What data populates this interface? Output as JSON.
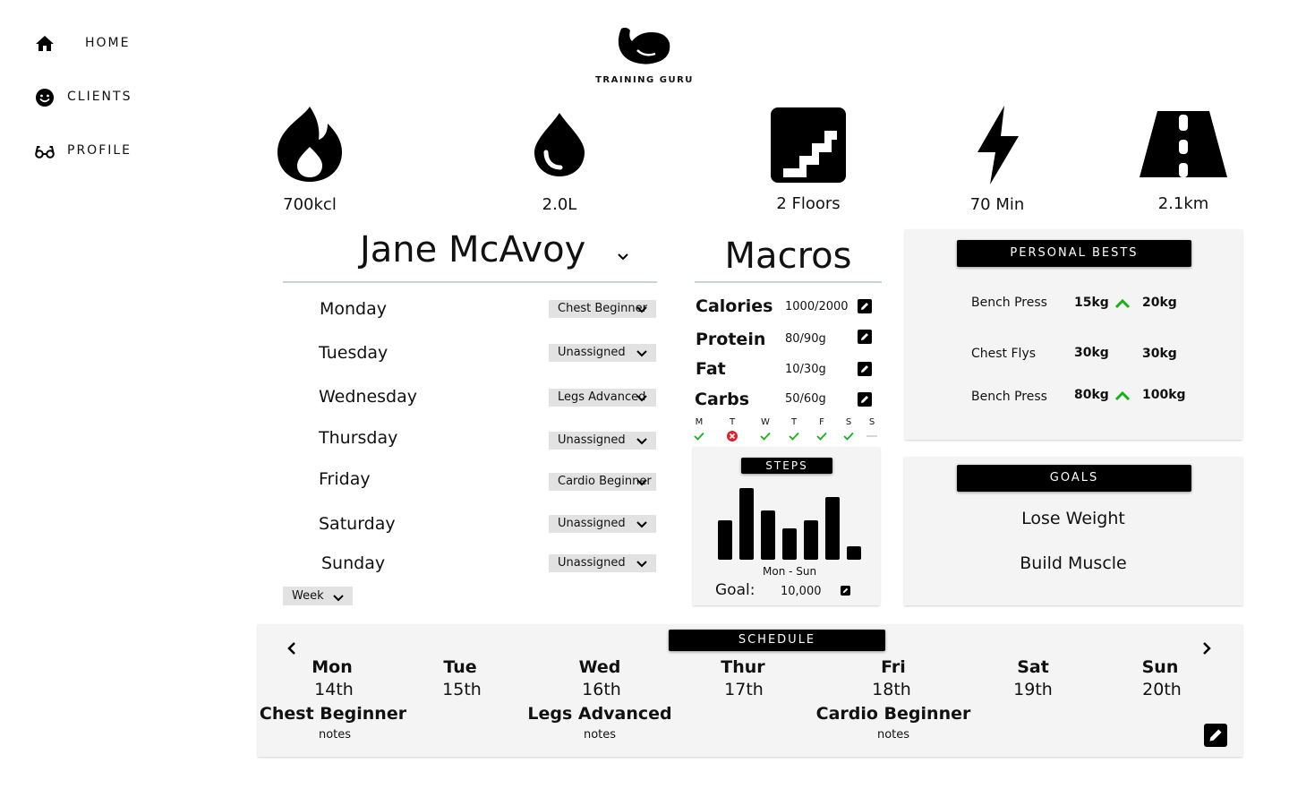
{
  "nav": {
    "items": [
      {
        "label": "HOME",
        "icon": "home-icon"
      },
      {
        "label": "CLIENTS",
        "icon": "smiley-icon"
      },
      {
        "label": "PROFILE",
        "icon": "glasses-icon"
      }
    ]
  },
  "brand": {
    "logo_text": "TRAINING GURU"
  },
  "stats": [
    {
      "label": "700kcl",
      "icon": "flame-icon"
    },
    {
      "label": "2.0L",
      "icon": "water-drop-icon"
    },
    {
      "label": "2 Floors",
      "icon": "stairs-icon"
    },
    {
      "label": "70 Min",
      "icon": "lightning-icon"
    },
    {
      "label": "2.1km",
      "icon": "road-icon"
    }
  ],
  "client": {
    "name": "Jane McAvoy",
    "days": [
      {
        "day": "Monday",
        "workout": "Chest Beginner"
      },
      {
        "day": "Tuesday",
        "workout": "Unassigned"
      },
      {
        "day": "Wednesday",
        "workout": "Legs Advanced"
      },
      {
        "day": "Thursday",
        "workout": "Unassigned"
      },
      {
        "day": "Friday",
        "workout": "Cardio Beginner"
      },
      {
        "day": "Saturday",
        "workout": "Unassigned"
      },
      {
        "day": "Sunday",
        "workout": "Unassigned"
      }
    ],
    "range_select": "Week"
  },
  "macros": {
    "title": "Macros",
    "items": [
      {
        "name": "Calories",
        "value": "1000/2000"
      },
      {
        "name": "Protein",
        "value": "80/90g"
      },
      {
        "name": "Fat",
        "value": "10/30g"
      },
      {
        "name": "Carbs",
        "value": "50/60g"
      }
    ],
    "week": [
      {
        "letter": "M",
        "status": "check"
      },
      {
        "letter": "T",
        "status": "fail"
      },
      {
        "letter": "W",
        "status": "check"
      },
      {
        "letter": "T",
        "status": "check"
      },
      {
        "letter": "F",
        "status": "check"
      },
      {
        "letter": "S",
        "status": "check"
      },
      {
        "letter": "S",
        "status": "none"
      }
    ]
  },
  "steps": {
    "title": "STEPS",
    "range_label": "Mon - Sun",
    "goal_label": "Goal:",
    "goal_value": "10,000",
    "relative_levels": [
      0.55,
      1.0,
      0.69,
      0.44,
      0.55,
      0.88,
      0.19
    ]
  },
  "personal_bests": {
    "title": "PERSONAL BESTS",
    "rows": [
      {
        "exercise": "Bench Press",
        "from": "15kg",
        "to": "20kg",
        "improved": true
      },
      {
        "exercise": "Chest Flys",
        "from": "30kg",
        "to": "30kg",
        "improved": false
      },
      {
        "exercise": "Bench Press",
        "from": "80kg",
        "to": "100kg",
        "improved": true
      }
    ]
  },
  "goals": {
    "title": "GOALS",
    "items": [
      "Lose Weight",
      "Build Muscle"
    ]
  },
  "schedule": {
    "title": "SCHEDULE",
    "days": [
      {
        "day": "Mon",
        "date": "14th",
        "workout": "Chest Beginner",
        "notes": "notes"
      },
      {
        "day": "Tue",
        "date": "15th",
        "workout": "",
        "notes": ""
      },
      {
        "day": "Wed",
        "date": "16th",
        "workout": "Legs Advanced",
        "notes": "notes"
      },
      {
        "day": "Thur",
        "date": "17th",
        "workout": "",
        "notes": ""
      },
      {
        "day": "Fri",
        "date": "18th",
        "workout": "Cardio Beginner",
        "notes": "notes"
      },
      {
        "day": "Sat",
        "date": "19th",
        "workout": "",
        "notes": ""
      },
      {
        "day": "Sun",
        "date": "20th",
        "workout": "",
        "notes": ""
      }
    ]
  },
  "colors": {
    "accent_green": "#17b117",
    "fail_red": "#e0202a",
    "card_bg": "#f4f4f4"
  }
}
